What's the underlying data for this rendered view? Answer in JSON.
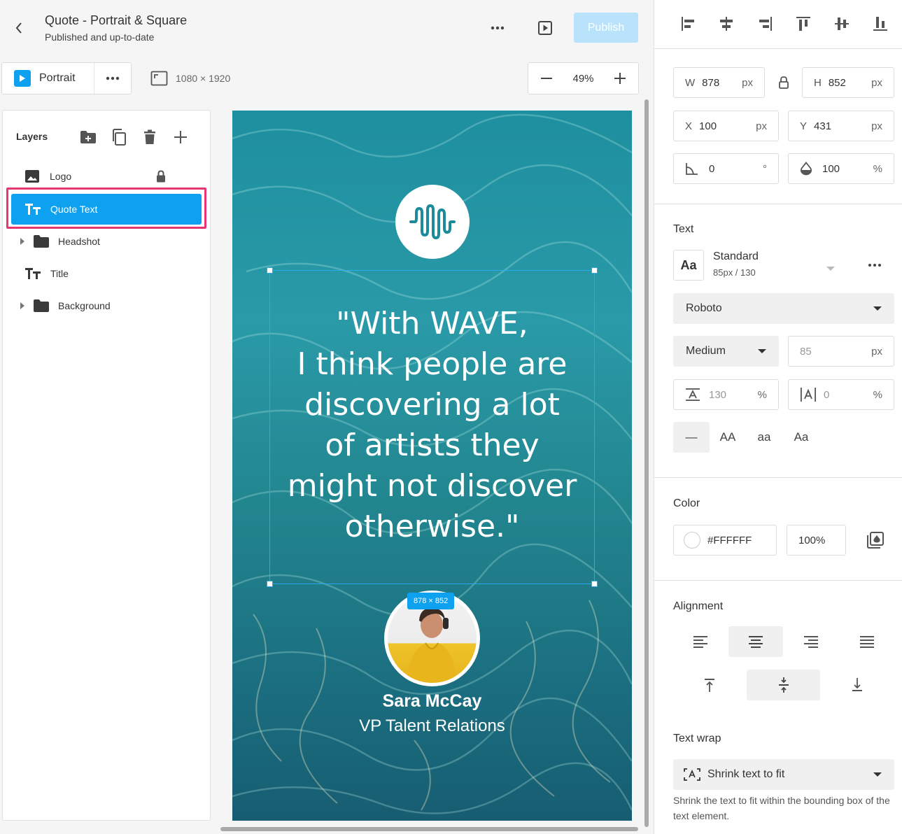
{
  "header": {
    "title": "Quote - Portrait & Square",
    "subtitle": "Published and up-to-date",
    "publish_label": "Publish"
  },
  "toolbar": {
    "format_label": "Portrait",
    "dimensions": "1080 × 1920",
    "zoom": "49%"
  },
  "layers": {
    "title": "Layers",
    "items": [
      {
        "label": "Logo",
        "icon": "image-icon",
        "locked": true
      },
      {
        "label": "Quote Text",
        "icon": "text-icon",
        "selected": true
      },
      {
        "label": "Headshot",
        "icon": "folder-icon",
        "expandable": true
      },
      {
        "label": "Title",
        "icon": "text-icon"
      },
      {
        "label": "Background",
        "icon": "folder-icon",
        "expandable": true
      }
    ]
  },
  "canvas": {
    "quote": "\"With WAVE, I think people are discovering a lot of artists they might not discover otherwise.\"",
    "quote_lines": [
      "\"With WAVE,",
      "I think people are",
      "discovering a lot",
      "of artists they",
      "might not discover",
      "otherwise.\""
    ],
    "size_badge": "878 × 852",
    "person_name": "Sara McCay",
    "person_role": "VP Talent Relations"
  },
  "properties": {
    "w": {
      "prefix": "W",
      "value": "878",
      "unit": "px"
    },
    "h": {
      "prefix": "H",
      "value": "852",
      "unit": "px"
    },
    "x": {
      "prefix": "X",
      "value": "100",
      "unit": "px"
    },
    "y": {
      "prefix": "Y",
      "value": "431",
      "unit": "px"
    },
    "rotation": {
      "value": "0",
      "unit": "°"
    },
    "opacity": {
      "value": "100",
      "unit": "%"
    }
  },
  "text": {
    "section_title": "Text",
    "style_icon_label": "Aa",
    "style_name": "Standard",
    "style_meta": "85px / 130",
    "font": "Roboto",
    "weight": "Medium",
    "size": {
      "value": "85",
      "unit": "px"
    },
    "line_height": {
      "value": "130",
      "unit": "%"
    },
    "letter_spacing": {
      "value": "0",
      "unit": "%"
    },
    "case_options": [
      "—",
      "AA",
      "aa",
      "Aa"
    ]
  },
  "color": {
    "section_title": "Color",
    "hex": "#FFFFFF",
    "opacity": "100%"
  },
  "alignment": {
    "section_title": "Alignment"
  },
  "text_wrap": {
    "section_title": "Text wrap",
    "value": "Shrink text to fit",
    "hint": "Shrink the text to fit within the bounding box of the text element."
  },
  "colors": {
    "accent": "#0ea1f0",
    "selection_outline": "#e8366e",
    "publish_disabled": "#b9e3fb"
  }
}
